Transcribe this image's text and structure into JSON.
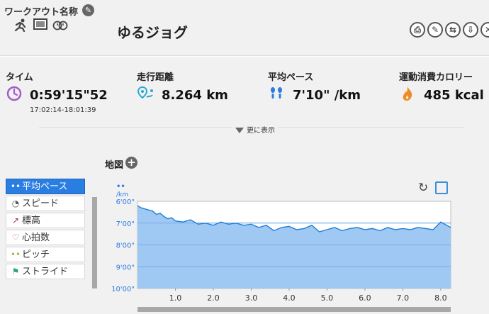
{
  "workout": {
    "label": "ワークアウト名称",
    "title": "ゆるジョグ"
  },
  "stats": {
    "time": {
      "label": "タイム",
      "value": "0:59'15\"52",
      "range": "17:02:14-18:01:39",
      "icon": "clock-icon"
    },
    "distance": {
      "label": "走行距離",
      "value": "8.264 km",
      "icon": "map-pin-icon"
    },
    "pace": {
      "label": "平均ペース",
      "value": "7'10\" /km",
      "icon": "footprints-icon"
    },
    "calories": {
      "label": "運動消費カロリー",
      "value": "485 kcal",
      "icon": "flame-icon"
    }
  },
  "more_label": "更に表示",
  "map_label": "地図",
  "menu": [
    {
      "label": "平均ペース",
      "icon": "footprints-icon",
      "active": true
    },
    {
      "label": "スピード",
      "icon": "speedometer-icon",
      "active": false
    },
    {
      "label": "標高",
      "icon": "elevation-icon",
      "active": false
    },
    {
      "label": "心拍数",
      "icon": "heart-icon",
      "active": false
    },
    {
      "label": "ピッチ",
      "icon": "steps-icon",
      "active": false
    },
    {
      "label": "ストライド",
      "icon": "runner-icon",
      "active": false
    }
  ],
  "chart_data": {
    "type": "area",
    "ylabel": "/km",
    "y_tick_labels": [
      "6'00\"",
      "7'00\"",
      "8'00\"",
      "9'00\"",
      "10'00\""
    ],
    "y_ticks_min": [
      6,
      7,
      8,
      9,
      10
    ],
    "ylim": [
      6,
      10
    ],
    "y_inverted": true,
    "x_tick_labels": [
      "1.0",
      "2.0",
      "3.0",
      "4.0",
      "5.0",
      "6.0",
      "7.0",
      "8.0"
    ],
    "x_ticks": [
      1,
      2,
      3,
      4,
      5,
      6,
      7,
      8
    ],
    "xlim": [
      0,
      8.264
    ],
    "grid": true,
    "series": [
      {
        "x": [
          0,
          0.1,
          0.2,
          0.3,
          0.4,
          0.5,
          0.6,
          0.7,
          0.8,
          0.9,
          1.0,
          1.2,
          1.4,
          1.6,
          1.8,
          2.0,
          2.2,
          2.4,
          2.6,
          2.8,
          3.0,
          3.2,
          3.4,
          3.6,
          3.8,
          4.0,
          4.2,
          4.4,
          4.6,
          4.8,
          5.0,
          5.2,
          5.4,
          5.6,
          5.8,
          6.0,
          6.2,
          6.4,
          6.6,
          6.8,
          7.0,
          7.2,
          7.4,
          7.6,
          7.8,
          8.0,
          8.264
        ],
        "values": [
          6.2,
          6.3,
          6.35,
          6.4,
          6.45,
          6.6,
          6.55,
          6.7,
          6.8,
          6.75,
          6.9,
          6.95,
          6.85,
          7.05,
          7.0,
          7.1,
          6.95,
          7.05,
          7.0,
          7.1,
          7.05,
          7.2,
          7.1,
          7.35,
          7.2,
          7.15,
          7.3,
          7.25,
          7.1,
          7.4,
          7.3,
          7.2,
          7.35,
          7.25,
          7.2,
          7.3,
          7.25,
          7.35,
          7.2,
          7.3,
          7.25,
          7.3,
          7.2,
          7.25,
          7.3,
          6.95,
          7.2
        ]
      }
    ],
    "area_color": "#9fc9f3",
    "line_color": "#1f7fd8"
  }
}
